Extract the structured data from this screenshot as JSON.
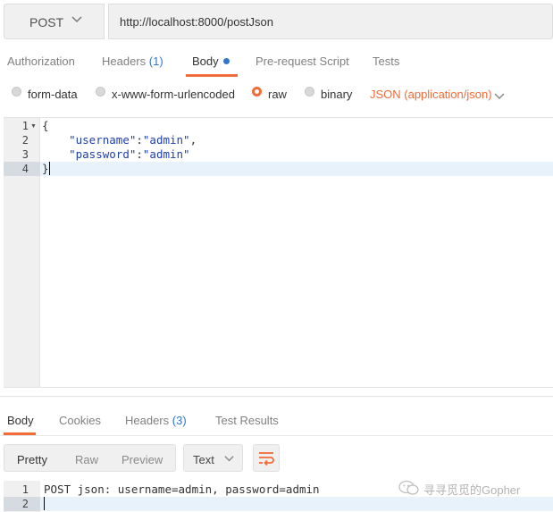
{
  "request": {
    "method": "POST",
    "url": "http://localhost:8000/postJson"
  },
  "request_tabs": [
    {
      "label": "Authorization",
      "count": ""
    },
    {
      "label": "Headers",
      "count": "(1)"
    },
    {
      "label": "Body",
      "count": ""
    },
    {
      "label": "Pre-request Script",
      "count": ""
    },
    {
      "label": "Tests",
      "count": ""
    }
  ],
  "active_request_tab": "Body",
  "body_types": [
    {
      "label": "form-data",
      "selected": false
    },
    {
      "label": "x-www-form-urlencoded",
      "selected": false
    },
    {
      "label": "raw",
      "selected": true
    },
    {
      "label": "binary",
      "selected": false
    }
  ],
  "content_type": "JSON (application/json)",
  "request_body": {
    "line_numbers": [
      "1",
      "2",
      "3",
      "4"
    ],
    "lines": [
      [
        {
          "t": "p",
          "v": "{"
        }
      ],
      [
        {
          "t": "p",
          "v": "    "
        },
        {
          "t": "s",
          "v": "\"username\""
        },
        {
          "t": "p",
          "v": ":"
        },
        {
          "t": "s",
          "v": "\"admin\""
        },
        {
          "t": "p",
          "v": ","
        }
      ],
      [
        {
          "t": "p",
          "v": "    "
        },
        {
          "t": "s",
          "v": "\"password\""
        },
        {
          "t": "p",
          "v": ":"
        },
        {
          "t": "s",
          "v": "\"admin\""
        }
      ],
      [
        {
          "t": "p",
          "v": "}"
        }
      ]
    ]
  },
  "response_tabs": [
    {
      "label": "Body",
      "count": ""
    },
    {
      "label": "Cookies",
      "count": ""
    },
    {
      "label": "Headers",
      "count": "(3)"
    },
    {
      "label": "Test Results",
      "count": ""
    }
  ],
  "response_view_modes": [
    "Pretty",
    "Raw",
    "Preview"
  ],
  "active_view_mode": "Pretty",
  "format_select": "Text",
  "response_body": {
    "line_numbers": [
      "1",
      "2"
    ],
    "lines": [
      "POST json: username=admin, password=admin",
      ""
    ]
  },
  "watermark": "寻寻觅觅的Gopher",
  "colors": {
    "accent": "#f26b3a",
    "count_blue": "#2f77c9",
    "string_blue": "#1f3fae"
  }
}
